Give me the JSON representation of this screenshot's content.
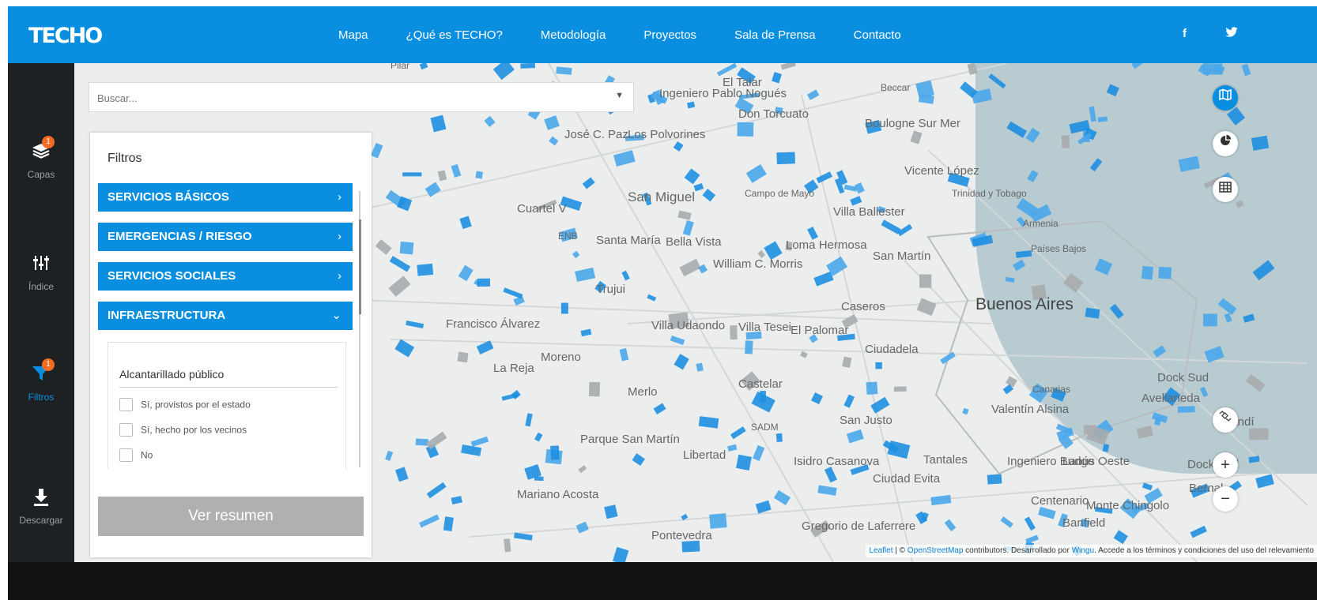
{
  "header": {
    "logo": "TECHO",
    "nav": [
      "Mapa",
      "¿Qué es TECHO?",
      "Metodología",
      "Proyectos",
      "Sala de Prensa",
      "Contacto"
    ],
    "social": {
      "facebook_icon": "facebook-icon",
      "twitter_icon": "twitter-icon"
    },
    "colors": {
      "primary": "#0a8fe0",
      "sidebar": "#1e2124",
      "badge": "#f36c21"
    }
  },
  "sidebar": {
    "items": [
      {
        "label": "Capas",
        "icon": "layers-icon",
        "badge": "1"
      },
      {
        "label": "Índice",
        "icon": "sliders-icon"
      },
      {
        "label": "Filtros",
        "icon": "filter-icon",
        "badge": "1",
        "active": true
      },
      {
        "label": "Descargar",
        "icon": "download-icon"
      }
    ]
  },
  "search": {
    "placeholder": "Buscar..."
  },
  "filters": {
    "title": "Filtros",
    "categories": [
      {
        "label": "SERVICIOS BÁSICOS",
        "chevron": "›"
      },
      {
        "label": "EMERGENCIAS / RIESGO",
        "chevron": "›"
      },
      {
        "label": "SERVICIOS SOCIALES",
        "chevron": "›"
      },
      {
        "label": "INFRAESTRUCTURA",
        "chevron": "⌄"
      }
    ],
    "subsection": {
      "title": "Alcantarillado público",
      "options": [
        "Sí, provistos por el estado",
        "Sí, hecho por los vecinos",
        "No"
      ]
    },
    "summary_button": "Ver resumen"
  },
  "map": {
    "places": [
      "Pilar",
      "El Talar",
      "Beccar",
      "Ingeniero Pablo Nogués",
      "Don Torcuato",
      "Boulogne Sur Mer",
      "José C. Paz",
      "Los Polvorines",
      "Vicente López",
      "Campo de Mayo",
      "Trinidad y Tobago",
      "San Miguel",
      "Villa Ballester",
      "Armenia",
      "Cuartel V",
      "Santa María",
      "Bella Vista",
      "Loma Hermosa",
      "Países Bajos",
      "San Martín",
      "William C. Morris",
      "Trujui",
      "Caseros",
      "Buenos Aires",
      "Francisco Álvarez",
      "Villa Udaondo",
      "Villa Tesei",
      "El Palomar",
      "Ciudadela",
      "Moreno",
      "La Reja",
      "Merlo",
      "Castelar",
      "Dock Sud",
      "Canarias",
      "Avellaneda",
      "Valentín Alsina",
      "SADM",
      "San Justo",
      "Sarandí",
      "Parque San Martín",
      "Libertad",
      "Isidro Casanova",
      "Tantales",
      "Ingeniero Budge",
      "Lanús Oeste",
      "Dock Sud",
      "Ciudad Evita",
      "Mariano Acosta",
      "Centenario",
      "Monte Chingolo",
      "Bernal",
      "Gregorio de Laferrere",
      "Banfield",
      "Pontevedra",
      "ENB"
    ],
    "attribution": {
      "leaflet": "Leaflet",
      "sep": " | © ",
      "osm": "OpenStreetMap",
      "text1": " contributors. Desarrollado por ",
      "wingu": "Wingu",
      "text2": ". Accede a los términos y condiciones del uso del relevamiento"
    },
    "controls": [
      "map-icon",
      "pie-chart-icon",
      "table-icon",
      "satellite-icon",
      "zoom-in-icon",
      "zoom-out-icon"
    ],
    "zoom_in": "+",
    "zoom_out": "−"
  }
}
